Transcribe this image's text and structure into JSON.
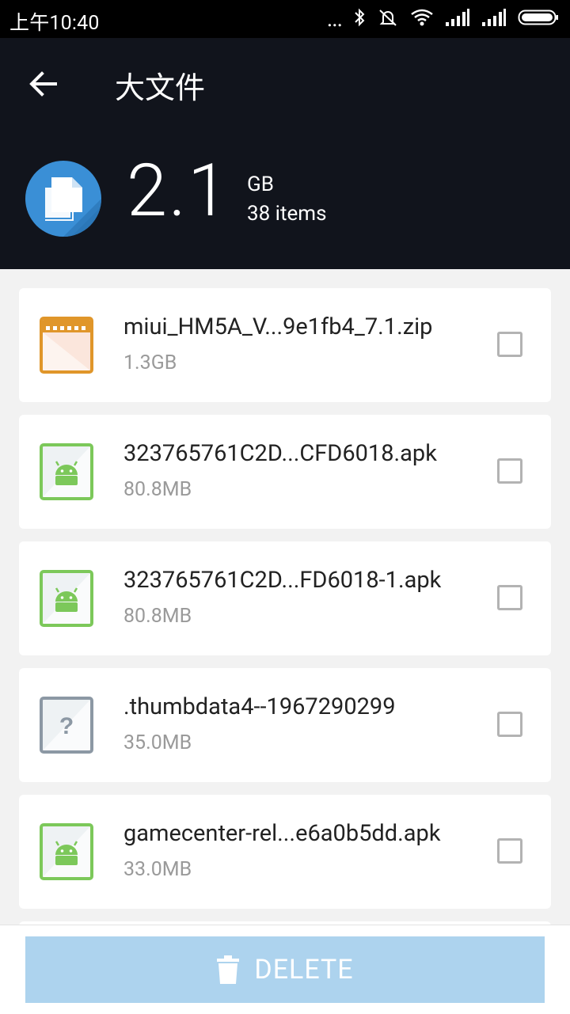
{
  "status_bar": {
    "time": "上午10:40",
    "dots": "...",
    "icons": [
      "bluetooth-icon",
      "vibrate-off-icon",
      "wifi-icon",
      "signal-icon",
      "signal-icon",
      "battery-icon"
    ]
  },
  "header": {
    "title": "大文件",
    "back_icon": "arrow-left-icon"
  },
  "summary": {
    "size": "2.1",
    "unit": "GB",
    "count": "38 items",
    "icon": "files-icon"
  },
  "files": [
    {
      "name": "miui_HM5A_V...9e1fb4_7.1.zip",
      "size": "1.3GB",
      "type": "zip"
    },
    {
      "name": "323765761C2D...CFD6018.apk",
      "size": "80.8MB",
      "type": "apk"
    },
    {
      "name": "323765761C2D...FD6018-1.apk",
      "size": "80.8MB",
      "type": "apk"
    },
    {
      "name": ".thumbdata4--1967290299",
      "size": "35.0MB",
      "type": "unknown"
    },
    {
      "name": "gamecenter-rel...e6a0b5dd.apk",
      "size": "33.0MB",
      "type": "apk"
    }
  ],
  "actions": {
    "delete_label": "DELETE"
  },
  "colors": {
    "header_bg": "#11141c",
    "accent_blue": "#3a8fd6",
    "apk_green": "#7cc85a",
    "zip_orange": "#e0962a",
    "unknown_gray": "#8c98a4",
    "delete_disabled": "#add3ee"
  }
}
